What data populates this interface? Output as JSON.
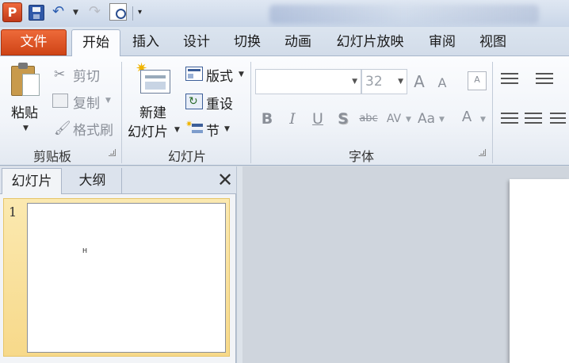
{
  "app": {
    "icon_letter": "P"
  },
  "quick_access": {
    "save": "save-icon",
    "undo": "undo-icon",
    "redo": "redo-icon",
    "print_preview": "print-preview-icon",
    "customize": "▾"
  },
  "tabs": {
    "file": "文件",
    "items": [
      "开始",
      "插入",
      "设计",
      "切换",
      "动画",
      "幻灯片放映",
      "审阅",
      "视图"
    ],
    "active": "开始"
  },
  "clipboard": {
    "paste": "粘贴",
    "cut": "剪切",
    "copy": "复制",
    "format_painter": "格式刷",
    "label": "剪贴板"
  },
  "slides_group": {
    "new_slide_line1": "新建",
    "new_slide_line2": "幻灯片",
    "layout": "版式",
    "reset": "重设",
    "section": "节",
    "label": "幻灯片"
  },
  "font_group": {
    "font_name": "",
    "font_size": "32",
    "grow": "A",
    "shrink": "A",
    "clear": "A",
    "bold": "B",
    "italic": "I",
    "underline": "U",
    "shadow": "S",
    "strike": "abc",
    "spacing": "AV",
    "case": "Aa",
    "color": "A",
    "label": "字体"
  },
  "panel": {
    "tab_slides": "幻灯片",
    "tab_outline": "大纲",
    "close": "✕",
    "slide_number": "1",
    "slide_text": "H"
  },
  "colors": {
    "file_tab": "#d24a1c",
    "selection": "#f7d98a",
    "accent": "#2f58a8"
  }
}
